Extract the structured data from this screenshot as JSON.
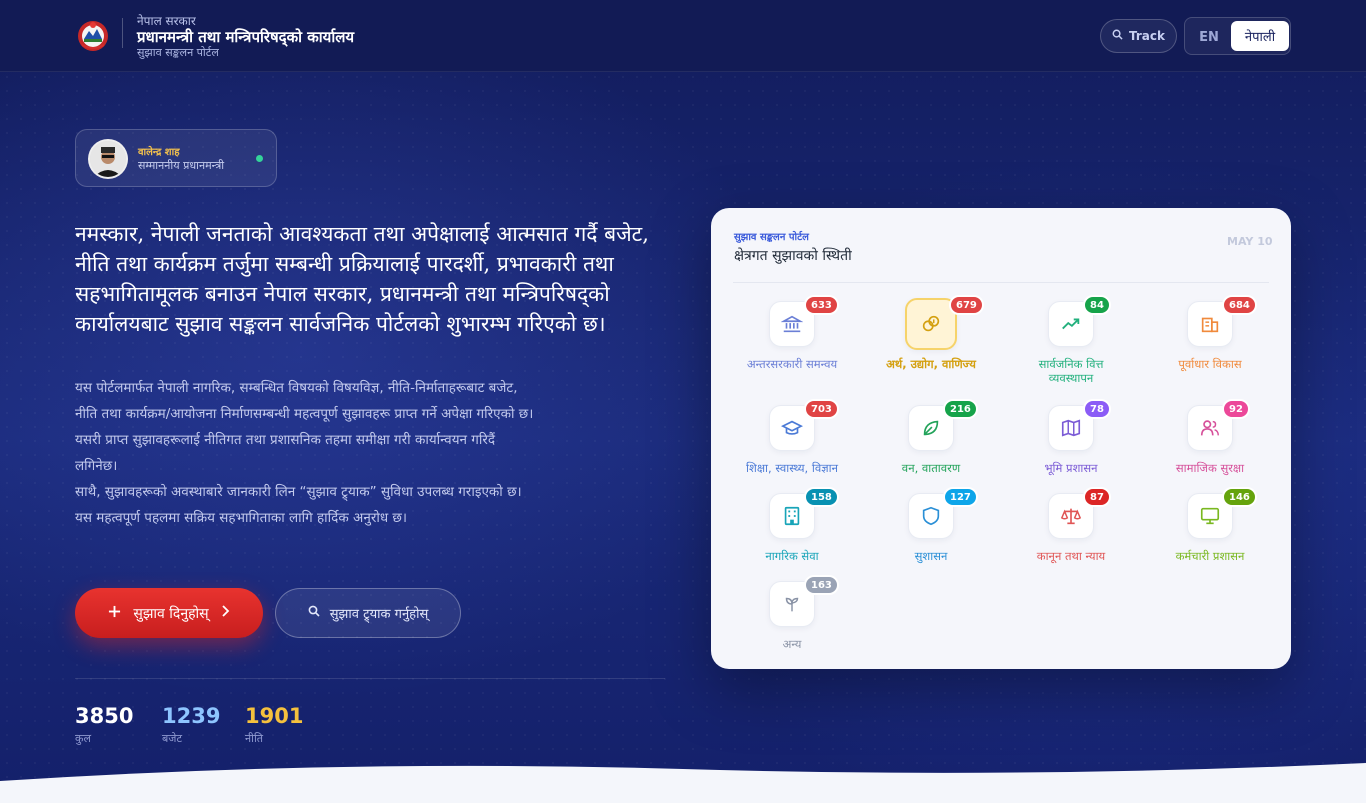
{
  "header": {
    "gov": "नेपाल सरकार",
    "office": "प्रधानमन्त्री तथा मन्त्रिपरिषद्को कार्यालय",
    "portal": "सुझाव सङ्कलन पोर्टल",
    "track_label": "Track",
    "lang_en": "EN",
    "lang_ne": "नेपाली"
  },
  "profile": {
    "name": "वालेन्द्र शाह",
    "role": "सम्माननीय प्रधानमन्त्री"
  },
  "hero": {
    "headline": "नमस्कार, नेपाली जनताको आवश्यकता तथा अपेक्षालाई आत्मसात गर्दै बजेट, नीति तथा कार्यक्रम तर्जुमा सम्बन्धी प्रक्रियालाई पारदर्शी, प्रभावकारी तथा सहभागितामूलक बनाउन नेपाल सरकार, प्रधानमन्त्री तथा मन्त्रिपरिषद्को कार्यालयबाट सुझाव सङ्कलन सार्वजनिक पोर्टलको शुभारम्भ गरिएको छ।",
    "p1": "यस पोर्टलमार्फत नेपाली नागरिक, सम्बन्धित विषयको विषयविज्ञ, नीति-निर्माताहरूबाट बजेट, नीति तथा कार्यक्रम/आयोजना निर्माणसम्बन्धी महत्वपूर्ण सुझावहरू प्राप्त गर्ने अपेक्षा गरिएको छ। यसरी प्राप्त सुझावहरूलाई नीतिगत तथा प्रशासनिक तहमा समीक्षा गरी कार्यान्वयन गरिदैं लगिनेछ।",
    "p2": "साथै, सुझावहरूको अवस्थाबारे जानकारी लिन “सुझाव ट्र्याक” सुविधा उपलब्ध गराइएको छ।",
    "p3": "यस महत्वपूर्ण पहलमा सक्रिय सहभागिताका लागि हार्दिक अनुरोध छ।",
    "primary_btn": "सुझाव दिनुहोस्",
    "secondary_btn": "सुझाव ट्र्याक गर्नुहोस्"
  },
  "stats": [
    {
      "value": "3850",
      "label": "कुल",
      "color": "#ffffff"
    },
    {
      "value": "1239",
      "label": "बजेट",
      "color": "#8ec5ff"
    },
    {
      "value": "1901",
      "label": "नीति",
      "color": "#f5c13d"
    }
  ],
  "card": {
    "subtitle": "सुझाव सङ्कलन पोर्टल",
    "title": "क्षेत्रगत सुझावको स्थिती",
    "date": "MAY 10",
    "tiles": [
      {
        "label": "अन्तरसरकारी समन्वय",
        "count": "633",
        "icon": "bank-icon",
        "color": "#6b7fd6",
        "badge": "#e04444"
      },
      {
        "label": "अर्थ, उद्योग, वाणिज्य",
        "count": "679",
        "icon": "coins-icon",
        "color": "#d4a010",
        "badge": "#e04444"
      },
      {
        "label": "सार्वजनिक वित्त व्यवस्थापन",
        "count": "84",
        "icon": "trend-up-icon",
        "color": "#22b07d",
        "badge": "#16a34a"
      },
      {
        "label": "पूर्वाधार विकास",
        "count": "684",
        "icon": "building-icon",
        "color": "#f08a3c",
        "badge": "#e04444"
      },
      {
        "label": "शिक्षा, स्वास्थ्य, विज्ञान",
        "count": "703",
        "icon": "graduation-cap-icon",
        "color": "#4b7ad6",
        "badge": "#e04444"
      },
      {
        "label": "वन, वातावरण",
        "count": "216",
        "icon": "leaf-icon",
        "color": "#22a35a",
        "badge": "#16a34a"
      },
      {
        "label": "भूमि प्रशासन",
        "count": "78",
        "icon": "map-icon",
        "color": "#7c5cd6",
        "badge": "#8b5cf6"
      },
      {
        "label": "सामाजिक सुरक्षा",
        "count": "92",
        "icon": "users-icon",
        "color": "#d6509a",
        "badge": "#ec4899"
      },
      {
        "label": "नागरिक सेवा",
        "count": "158",
        "icon": "office-icon",
        "color": "#18a4b8",
        "badge": "#0891b2"
      },
      {
        "label": "सुशासन",
        "count": "127",
        "icon": "shield-icon",
        "color": "#2a8fd6",
        "badge": "#0ea5e9"
      },
      {
        "label": "कानून तथा न्याय",
        "count": "87",
        "icon": "scales-icon",
        "color": "#e05555",
        "badge": "#dc2626"
      },
      {
        "label": "कर्मचारी प्रशासन",
        "count": "146",
        "icon": "monitor-icon",
        "color": "#7ab820",
        "badge": "#65a30d"
      },
      {
        "label": "अन्य",
        "count": "163",
        "icon": "sprout-icon",
        "color": "#8a93a6",
        "badge": "#9aa3b5"
      }
    ]
  }
}
